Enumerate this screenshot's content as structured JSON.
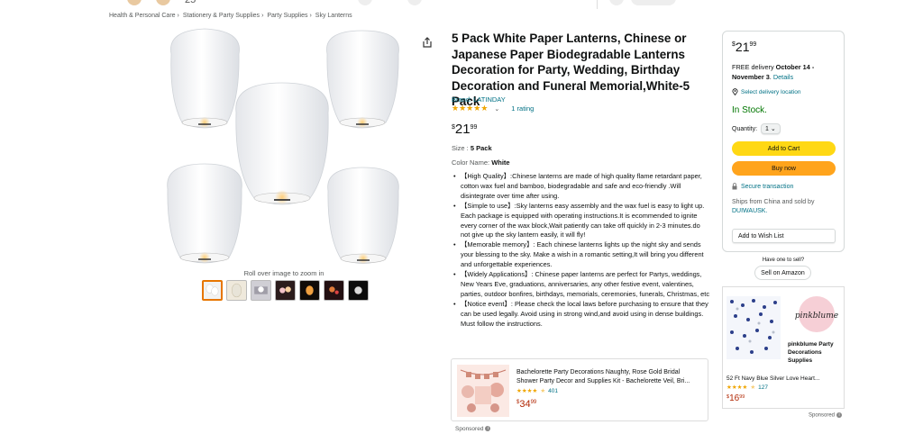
{
  "top_strip": {
    "count": "25"
  },
  "breadcrumb": [
    "Health & Personal Care",
    "Stationery & Party Supplies",
    "Party Supplies",
    "Sky Lanterns"
  ],
  "gallery": {
    "zoom_hint": "Roll over image to zoom in",
    "thumb_count": 7,
    "thumb_colors": [
      "#f2f2f2",
      "#efe9dc",
      "#d0cfd5",
      "#2b1c1c",
      "#100b08",
      "#231012",
      "#0c0c0c"
    ]
  },
  "product": {
    "title": "5 Pack White Paper Lanterns, Chinese or Japanese Paper Biodegradable Lanterns Decoration for Party, Wedding, Birthday Decoration and Funeral Memorial,White-5 Pack",
    "brand": "Brand: LATINDAY",
    "rating_stars": 5,
    "rating_count": "1 rating",
    "price": {
      "symbol": "$",
      "whole": "21",
      "fraction": "99"
    },
    "size_label": "Size : ",
    "size_value": "5 Pack",
    "color_label": "Color Name: ",
    "color_value": "White",
    "bullets": [
      "【High Quality】:Chinese lanterns are made of high quality flame retardant paper, cotton wax fuel and bamboo, biodegradable and safe and eco-friendly .Will disintegrate over time after using.",
      "【Simple to use】:Sky lanterns easy assembly and the wax fuel is easy to light up. Each package is equipped with operating instructions.It is ecommended to ignite every corner of the wax block,Wait patiently can take off quickly in 2-3 minutes.do not give up the sky lantern easily, it will fly!",
      "【Memorable memory】: Each chinese lanterns lights up the night sky and sends your blessing to the sky. Make a wish in a romantic setting,It will bring you different and unforgettable experiences.",
      "【Widely Applications】: Chinese paper lanterns are perfect for Partys, weddings, New Years Eve, graduations, anniversaries, any other festive event, valentines, parties, outdoor bonfires, birthdays, memorials, ceremonies, funerals, Christmas, etc",
      "【Notice event】: Please check the local laws before purchasing to ensure that they can be used legally. Avoid using in strong wind,and avoid using in dense buildings. Must follow the instructions."
    ]
  },
  "sponsored_center": {
    "title": "Bachelorette Party Decorations Naughty, Rose Gold Bridal Shower Party Decor and Supplies Kit - Bachelorette Veil, Bri...",
    "rating_count": "401",
    "price": {
      "symbol": "$",
      "whole": "34",
      "fraction": "99"
    },
    "label": "Sponsored"
  },
  "buybox": {
    "price": {
      "symbol": "$",
      "whole": "21",
      "fraction": "99"
    },
    "delivery_prefix": "FREE delivery ",
    "delivery_dates": "October 14 - November 3",
    "delivery_suffix": ". ",
    "details_link": "Details",
    "location_link": "Select delivery location",
    "stock": "In Stock.",
    "qty_label": "Quantity:",
    "qty_value": "1",
    "add_to_cart": "Add to Cart",
    "buy_now": "Buy now",
    "secure": "Secure transaction",
    "ships_from": "Ships from China and sold by ",
    "seller": "DUIWAUSK.",
    "wishlist": "Add to Wish List"
  },
  "sell": {
    "question": "Have one to sell?",
    "button": "Sell on Amazon"
  },
  "right_ad": {
    "logo_text": "pinkblume",
    "brand": "pinkblume Party Decorations Supplies",
    "title": "52 Ft Navy Blue Silver Love Heart...",
    "rating_count": "127",
    "price": {
      "symbol": "$",
      "whole": "16",
      "fraction": "99"
    },
    "label": "Sponsored"
  }
}
